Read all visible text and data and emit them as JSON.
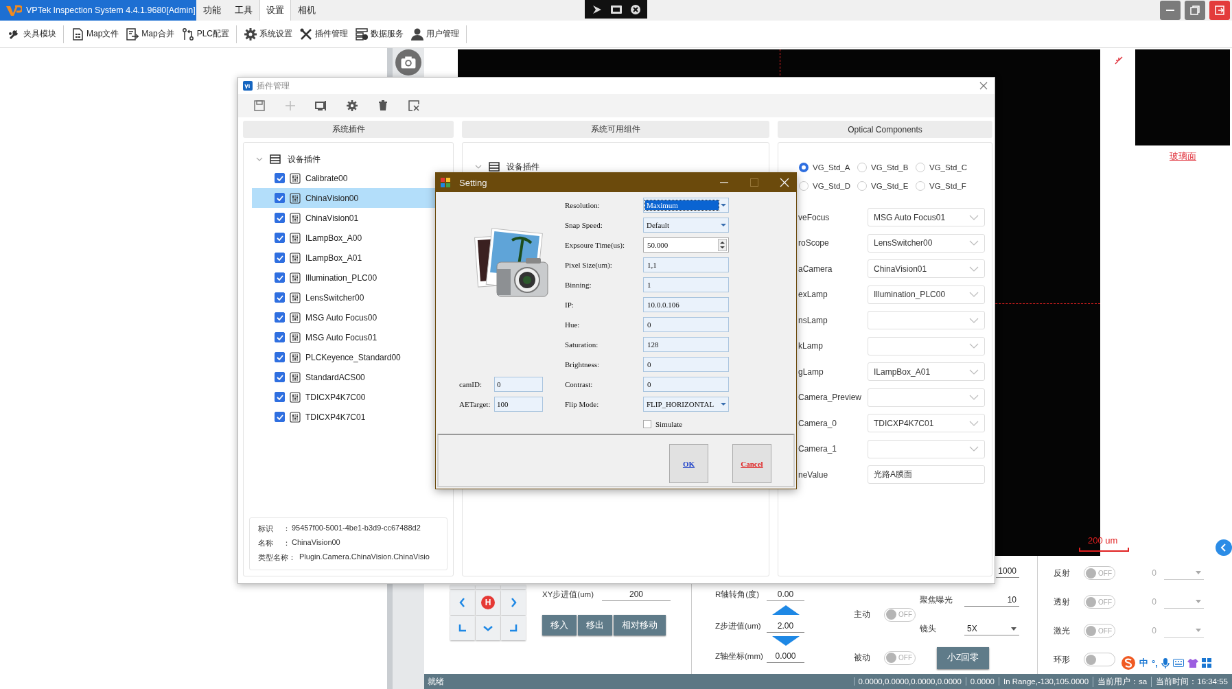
{
  "app": {
    "title": "VPTek Inspection System 4.4.1.9680[Admin]",
    "menus": [
      {
        "label": "功能",
        "selected": false
      },
      {
        "label": "工具",
        "selected": false
      },
      {
        "label": "设置",
        "selected": true
      },
      {
        "label": "相机",
        "selected": false
      }
    ]
  },
  "toolbar": [
    {
      "kind": "fixture",
      "label": "夹具模块",
      "separator_after": true
    },
    {
      "kind": "map_file",
      "label": "Map文件",
      "separator_after": false
    },
    {
      "kind": "map_merge",
      "label": "Map合并",
      "separator_after": false
    },
    {
      "kind": "plc",
      "label": "PLC配置",
      "separator_after": true
    },
    {
      "kind": "settings",
      "label": "系统设置",
      "separator_after": false
    },
    {
      "kind": "plugins",
      "label": "插件管理",
      "separator_after": false
    },
    {
      "kind": "data",
      "label": "数据服务",
      "separator_after": false
    },
    {
      "kind": "users",
      "label": "用户管理",
      "separator_after": true
    }
  ],
  "viewer": {
    "surface_link": "玻璃面",
    "scale_label": "200 um"
  },
  "plugin_window": {
    "title": "插件管理",
    "tools": [
      {
        "kind": "save",
        "disabled": false
      },
      {
        "kind": "add",
        "disabled": true
      },
      {
        "kind": "display",
        "disabled": false
      },
      {
        "kind": "settings",
        "disabled": false
      },
      {
        "kind": "delete",
        "disabled": false
      },
      {
        "kind": "clear",
        "disabled": false
      }
    ],
    "system_plugins": {
      "header": "系统插件",
      "tree": {
        "label": "设备插件",
        "expanded": true,
        "children": [
          {
            "label": "Calibrate00",
            "checked": true,
            "selected": false
          },
          {
            "label": "ChinaVision00",
            "checked": true,
            "selected": true
          },
          {
            "label": "ChinaVision01",
            "checked": true,
            "selected": false
          },
          {
            "label": "ILampBox_A00",
            "checked": true,
            "selected": false
          },
          {
            "label": "ILampBox_A01",
            "checked": true,
            "selected": false
          },
          {
            "label": "Illumination_PLC00",
            "checked": true,
            "selected": false
          },
          {
            "label": "LensSwitcher00",
            "checked": true,
            "selected": false
          },
          {
            "label": "MSG Auto Focus00",
            "checked": true,
            "selected": false
          },
          {
            "label": "MSG Auto Focus01",
            "checked": true,
            "selected": false
          },
          {
            "label": "PLCKeyence_Standard00",
            "checked": true,
            "selected": false
          },
          {
            "label": "StandardACS00",
            "checked": true,
            "selected": false
          },
          {
            "label": "TDICXP4K7C00",
            "checked": true,
            "selected": false
          },
          {
            "label": "TDICXP4K7C01",
            "checked": true,
            "selected": false
          }
        ]
      },
      "info": [
        {
          "key": "标识",
          "separator": "：",
          "value": "95457f00-5001-4be1-b3d9-cc67488d2"
        },
        {
          "key": "名称",
          "separator": "：",
          "value": "ChinaVision00"
        },
        {
          "key": "类型名称：",
          "value": "Plugin.Camera.ChinaVision.ChinaVisio"
        }
      ]
    },
    "available": {
      "header": "系统可用组件",
      "tree": {
        "label": "设备插件",
        "expanded": true
      }
    },
    "optical": {
      "header": "Optical Components",
      "presets": [
        {
          "label": "VG_Std_A",
          "selected": true
        },
        {
          "label": "VG_Std_B",
          "selected": false
        },
        {
          "label": "VG_Std_C",
          "selected": false
        },
        {
          "label": "VG_Std_D",
          "selected": false
        },
        {
          "label": "VG_Std_E",
          "selected": false
        },
        {
          "label": "VG_Std_F",
          "selected": false
        }
      ],
      "rows": [
        {
          "label": "veFocus",
          "kind": "combo",
          "value": "MSG Auto Focus01"
        },
        {
          "label": "roScope",
          "kind": "combo",
          "value": "LensSwitcher00"
        },
        {
          "label": "aCamera",
          "kind": "combo",
          "value": "ChinaVision01"
        },
        {
          "label": "exLamp",
          "kind": "combo",
          "value": "Illumination_PLC00"
        },
        {
          "label": "nsLamp",
          "kind": "combo"
        },
        {
          "label": "kLamp",
          "kind": "combo"
        },
        {
          "label": "gLamp",
          "kind": "combo",
          "value": "ILampBox_A01"
        },
        {
          "label": "Camera_Preview",
          "kind": "combo"
        },
        {
          "label": "Camera_0",
          "kind": "combo",
          "value": "TDICXP4K7C01"
        },
        {
          "label": "Camera_1",
          "kind": "combo"
        },
        {
          "label": "neValue",
          "kind": "text",
          "value": "光路A膜面"
        }
      ]
    }
  },
  "setting": {
    "title": "Setting",
    "fields": [
      {
        "label": "Resolution:",
        "kind": "combo",
        "value": "Maximum",
        "highlighted": true
      },
      {
        "label": "Snap Speed:",
        "kind": "combo",
        "value": "Default",
        "highlighted": false
      },
      {
        "label": "Expsoure Time(us):",
        "kind": "spin",
        "value": "50.000",
        "highlighted": false
      },
      {
        "label": "Pixel Size(um):",
        "kind": "text",
        "value": "1,1",
        "highlighted": false
      },
      {
        "label": "Binning:",
        "kind": "text",
        "value": "1",
        "highlighted": false
      },
      {
        "label": "IP:",
        "kind": "text",
        "value": "10.0.0.106",
        "highlighted": false
      },
      {
        "label": "Hue:",
        "kind": "text",
        "value": "0",
        "highlighted": false
      },
      {
        "label": "Saturation:",
        "kind": "text",
        "value": "128",
        "highlighted": false
      },
      {
        "label": "Brightness:",
        "kind": "text",
        "value": "0",
        "highlighted": false
      },
      {
        "label": "Contrast:",
        "kind": "text",
        "value": "0",
        "highlighted": false
      },
      {
        "label": "Flip Mode:",
        "kind": "combo",
        "value": "FLIP_HORIZONTAL",
        "highlighted": false
      }
    ],
    "side_fields": [
      {
        "label": "camID:",
        "value": "0"
      },
      {
        "label": "AETarget:",
        "value": "100"
      }
    ],
    "simulate": {
      "label": "Simulate",
      "checked": false
    },
    "buttons": [
      {
        "kind": "ok",
        "label": "OK"
      },
      {
        "kind": "cancel",
        "label": "Cancel"
      }
    ]
  },
  "stage": {
    "pad": [
      {
        "kind": "blank"
      },
      {
        "kind": "blank"
      },
      {
        "kind": "blank"
      },
      {
        "kind": "left"
      },
      {
        "kind": "home",
        "label": "H"
      },
      {
        "kind": "right"
      },
      {
        "kind": "corner_left"
      },
      {
        "kind": "down"
      },
      {
        "kind": "corner_right"
      }
    ],
    "xy_step": {
      "label": "XY步进值(um)",
      "value": "200"
    },
    "buttons": [
      "移入",
      "移出",
      "相对移动"
    ],
    "r_angle": {
      "label": "R轴转角(度)",
      "value": "0.00"
    },
    "z_step": {
      "label": "Z步进值(um)",
      "value": "2.00"
    },
    "z_position": {
      "label": "Z轴坐标(mm)",
      "value": "0.000"
    }
  },
  "focus": {
    "top_value": "1000",
    "exposure": {
      "label": "聚焦曝光",
      "value": "10"
    },
    "active": {
      "label": "主动",
      "on": false,
      "state_text": "OFF"
    },
    "lens": {
      "label": "镜头",
      "value": "5X"
    },
    "passive": {
      "label": "被动",
      "on": false,
      "state_text": "OFF"
    },
    "zero_button": "小Z回零"
  },
  "lights": [
    {
      "label": "反射",
      "on": false,
      "state_text": "OFF",
      "value": "0"
    },
    {
      "label": "透射",
      "on": false,
      "state_text": "OFF",
      "value": "0"
    },
    {
      "label": "激光",
      "on": false,
      "state_text": "OFF",
      "value": "0"
    },
    {
      "label": "环形",
      "on": false
    }
  ],
  "ime": {
    "mode": "中",
    "punct": "°,"
  },
  "status_bar": [
    "就绪",
    "0.0000,0.0000,0.0000,0.0000",
    "0.0000",
    "In Range,-130,105.0000",
    "当前用户：sa",
    "当前时间：16:34:55"
  ]
}
